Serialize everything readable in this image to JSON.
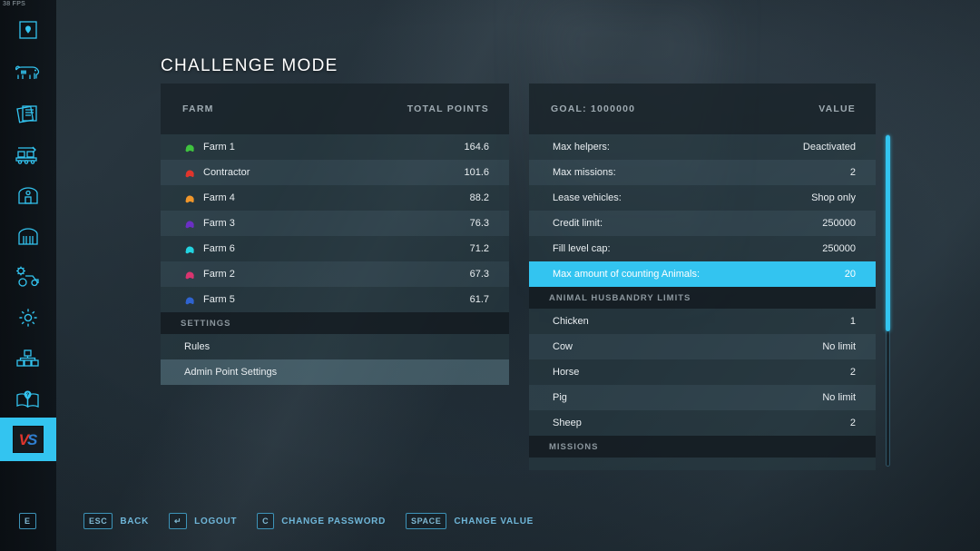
{
  "hud": {
    "fps": "38 FPS",
    "interact_key": "E"
  },
  "page_title": "CHALLENGE MODE",
  "colors": {
    "accent": "#33c4f0",
    "row_odd": "#283a42",
    "row_even": "#3a525c",
    "text": "#e9eef1",
    "muted": "#9fabb2"
  },
  "sidebar": {
    "items": [
      {
        "name": "map-marker-icon",
        "label": "Map"
      },
      {
        "name": "cow-icon",
        "label": "Animals"
      },
      {
        "name": "documents-icon",
        "label": "Contracts"
      },
      {
        "name": "production-icon",
        "label": "Production"
      },
      {
        "name": "barn-icon",
        "label": "Buildings"
      },
      {
        "name": "animal-pen-icon",
        "label": "Animal Pens"
      },
      {
        "name": "vehicle-settings-icon",
        "label": "Vehicles"
      },
      {
        "name": "gear-icon",
        "label": "Settings"
      },
      {
        "name": "network-icon",
        "label": "Statistics"
      },
      {
        "name": "help-book-icon",
        "label": "Help"
      },
      {
        "name": "versus-icon",
        "label": "Challenge Mode",
        "active": true
      }
    ]
  },
  "left_panel": {
    "header": {
      "farm": "FARM",
      "points": "TOTAL POINTS"
    },
    "farms": [
      {
        "name": "Farm 1",
        "points": "164.6",
        "color": "#3fc23f"
      },
      {
        "name": "Contractor",
        "points": "101.6",
        "color": "#e0352c"
      },
      {
        "name": "Farm 4",
        "points": "88.2",
        "color": "#f0962b"
      },
      {
        "name": "Farm 3",
        "points": "76.3",
        "color": "#6b2fc4"
      },
      {
        "name": "Farm 6",
        "points": "71.2",
        "color": "#23d3e0"
      },
      {
        "name": "Farm 2",
        "points": "67.3",
        "color": "#d9346f"
      },
      {
        "name": "Farm 5",
        "points": "61.7",
        "color": "#2f63d0"
      }
    ],
    "settings_section": "SETTINGS",
    "settings_items": [
      {
        "label": "Rules",
        "selected": false
      },
      {
        "label": "Admin Point Settings",
        "selected": true
      }
    ]
  },
  "right_panel": {
    "header": {
      "goal": "GOAL: 1000000",
      "value": "VALUE"
    },
    "rows": [
      {
        "label": "Max helpers:",
        "value": "Deactivated",
        "selected": false
      },
      {
        "label": "Max missions:",
        "value": "2",
        "selected": false
      },
      {
        "label": "Lease vehicles:",
        "value": "Shop only",
        "selected": false
      },
      {
        "label": "Credit limit:",
        "value": "250000",
        "selected": false
      },
      {
        "label": "Fill level cap:",
        "value": "250000",
        "selected": false
      },
      {
        "label": "Max amount of counting Animals:",
        "value": "20",
        "selected": true
      }
    ],
    "animal_section": "ANIMAL HUSBANDRY LIMITS",
    "animal_rows": [
      {
        "label": "Chicken",
        "value": "1"
      },
      {
        "label": "Cow",
        "value": "No limit"
      },
      {
        "label": "Horse",
        "value": "2"
      },
      {
        "label": "Pig",
        "value": "No limit"
      },
      {
        "label": "Sheep",
        "value": "2"
      }
    ],
    "missions_section": "MISSIONS"
  },
  "action_bar": [
    {
      "key": "ESC",
      "label": "BACK"
    },
    {
      "key": "↵",
      "label": "LOGOUT"
    },
    {
      "key": "C",
      "label": "CHANGE PASSWORD"
    },
    {
      "key": "SPACE",
      "label": "CHANGE VALUE"
    }
  ]
}
